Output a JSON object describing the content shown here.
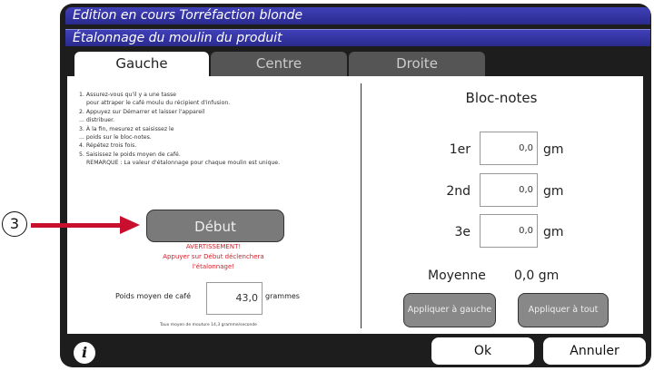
{
  "title_bar": "Edition en cours Torréfaction blonde",
  "subtitle_bar": "Étalonnage du moulin du produit",
  "tabs": [
    {
      "label": "Gauche",
      "active": true
    },
    {
      "label": "Centre",
      "active": false
    },
    {
      "label": "Droite",
      "active": false
    }
  ],
  "instructions": [
    "1. Assurez-vous qu'il y a une tasse",
    "pour attraper le café moulu du récipient d'infusion.",
    "2. Appuyez sur Démarrer et laisser l'appareil",
    "... distribuer.",
    "3. À la fin, mesurez et saisissez le",
    "... poids sur le bloc-notes.",
    "4. Répétez trois fois.",
    "5. Saisissez le poids moyen de café.",
    "REMARQUE : La valeur d'étalonnage pour chaque moulin est unique."
  ],
  "start_button": "Début",
  "warning": {
    "title": "AVERTISSEMENT!",
    "line1": "Appuyer sur Début déclenchera",
    "line2": "l'étalonnage!"
  },
  "avg_weight": {
    "label": "Poids moyen de café",
    "value": "43,0",
    "unit": "grammes"
  },
  "rate_text": "Taux moyen de mouture 14,3 gramme/seconde",
  "notepad": {
    "title": "Bloc-notes",
    "rows": [
      {
        "label": "1er",
        "value": "0,0",
        "unit": "gm"
      },
      {
        "label": "2nd",
        "value": "0,0",
        "unit": "gm"
      },
      {
        "label": "3e",
        "value": "0,0",
        "unit": "gm"
      }
    ],
    "average_label": "Moyenne",
    "average_value": "0,0 gm"
  },
  "apply_left": "Appliquer à gauche",
  "apply_all": "Appliquer à tout",
  "ok_button": "Ok",
  "cancel_button": "Annuler",
  "callout_number": "3",
  "colors": {
    "title_bar": "#2f2fa0",
    "warning": "#d0202a",
    "arrow": "#c8102e"
  }
}
